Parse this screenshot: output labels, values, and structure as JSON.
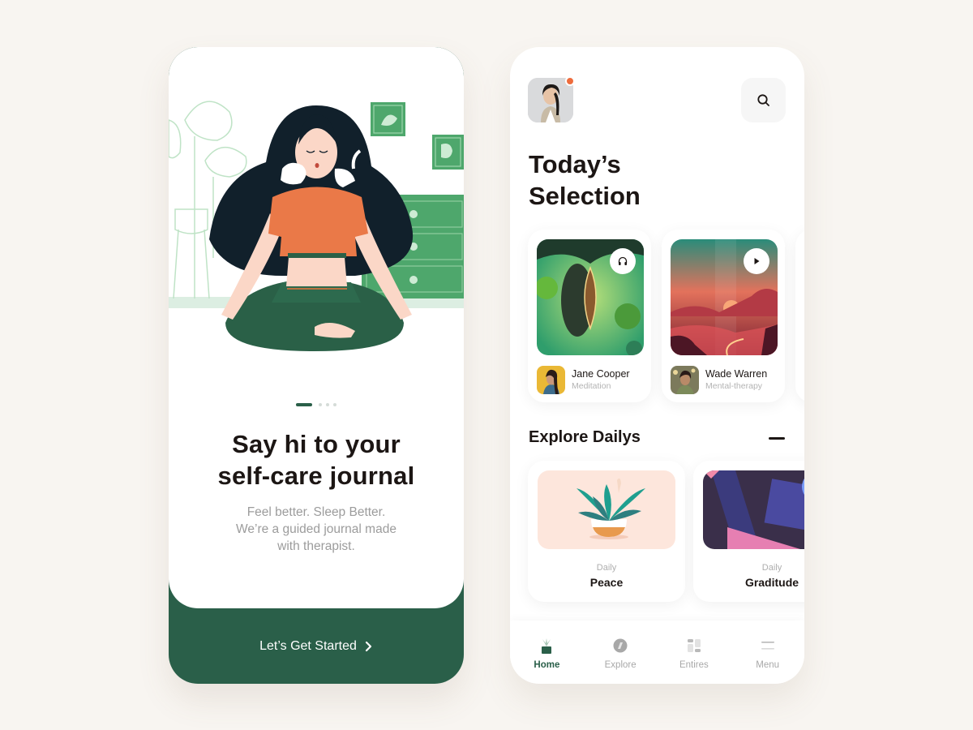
{
  "onboarding": {
    "pager": {
      "total": 4,
      "active": 1
    },
    "title_line1": "Say hi to your",
    "title_line2": "self-care journal",
    "subtitle_line1": "Feel better. Sleep Better.",
    "subtitle_line2": "We’re a guided journal made",
    "subtitle_line3": "with therapist.",
    "cta_label": "Let’s Get Started",
    "cta_icon": "chevron-right-icon",
    "colors": {
      "primary": "#2a5f49",
      "shirt": "#ea7948",
      "hair": "#11202b"
    }
  },
  "home": {
    "avatar": {
      "notification_dot": true,
      "dot_color": "#ee6c3d"
    },
    "search_icon": "search-icon",
    "title_line1": "Today’s",
    "title_line2": "Selection",
    "selection": [
      {
        "name": "Jane Cooper",
        "category": "Meditation",
        "action_icon": "headphones-icon"
      },
      {
        "name": "Wade Warren",
        "category": "Mental-therapy",
        "action_icon": "play-icon"
      }
    ],
    "explore_title": "Explore Dailys",
    "dailys": [
      {
        "label": "Daily",
        "title": "Peace"
      },
      {
        "label": "Daily",
        "title": "Graditude"
      }
    ],
    "tabs": [
      {
        "label": "Home",
        "icon": "plant-icon",
        "active": true
      },
      {
        "label": "Explore",
        "icon": "compass-icon",
        "active": false
      },
      {
        "label": "Entires",
        "icon": "grid-icon",
        "active": false
      },
      {
        "label": "Menu",
        "icon": "menu-icon",
        "active": false
      }
    ]
  }
}
